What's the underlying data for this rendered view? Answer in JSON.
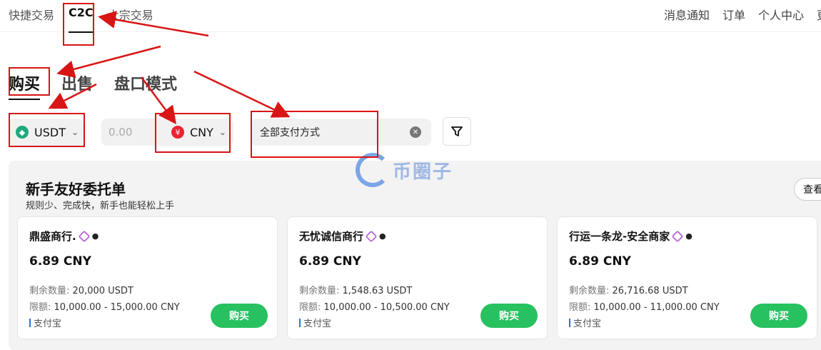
{
  "top_nav": {
    "left": [
      "快捷交易",
      "C2C",
      "大宗交易"
    ],
    "right": [
      "消息通知",
      "订单",
      "个人中心",
      "更"
    ]
  },
  "tabs": [
    "购买",
    "出售",
    "盘口模式"
  ],
  "filters": {
    "coin": "USDT",
    "amount_placeholder": "0.00",
    "currency": "CNY",
    "payment": "全部支付方式"
  },
  "panel": {
    "title": "新手友好委托单",
    "subtitle": "规则少、完成快，新手也能轻松上手",
    "view_button": "查看"
  },
  "cards": [
    {
      "merchant": "鼎盛商行.",
      "price": "6.89 CNY",
      "remaining_label": "剩余数量:",
      "remaining": "20,000 USDT",
      "limit_label": "限额:",
      "limit": "10,000.00 - 15,000.00 CNY",
      "payment": "支付宝",
      "buy": "购买"
    },
    {
      "merchant": "无忧诚信商行",
      "price": "6.89 CNY",
      "remaining_label": "剩余数量:",
      "remaining": "1,548.63 USDT",
      "limit_label": "限额:",
      "limit": "10,000.00 - 10,500.00 CNY",
      "payment": "支付宝",
      "buy": "购买"
    },
    {
      "merchant": "行运一条龙-安全商家",
      "price": "6.89 CNY",
      "remaining_label": "剩余数量:",
      "remaining": "26,716.68 USDT",
      "limit_label": "限额:",
      "limit": "10,000.00 - 11,000.00 CNY",
      "payment": "支付宝",
      "buy": "购买"
    }
  ],
  "watermark": "币圈子",
  "colors": {
    "annotation_red": "#d91414",
    "buy_green": "#27c160",
    "badge_purple": "#b45bd6"
  }
}
